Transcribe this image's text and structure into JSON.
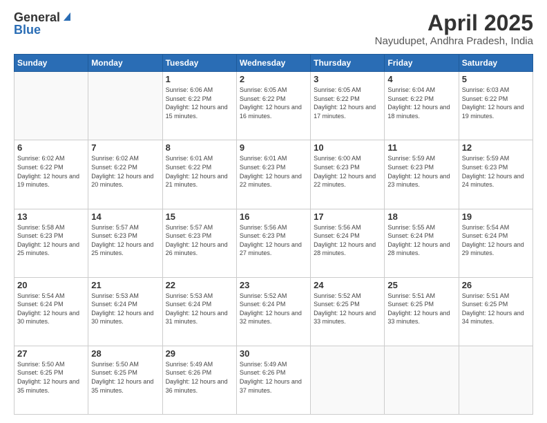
{
  "header": {
    "logo_general": "General",
    "logo_blue": "Blue",
    "title": "April 2025",
    "location": "Nayudupet, Andhra Pradesh, India"
  },
  "days_of_week": [
    "Sunday",
    "Monday",
    "Tuesday",
    "Wednesday",
    "Thursday",
    "Friday",
    "Saturday"
  ],
  "weeks": [
    [
      {
        "day": "",
        "sunrise": "",
        "sunset": "",
        "daylight": "",
        "empty": true
      },
      {
        "day": "",
        "sunrise": "",
        "sunset": "",
        "daylight": "",
        "empty": true
      },
      {
        "day": "1",
        "sunrise": "Sunrise: 6:06 AM",
        "sunset": "Sunset: 6:22 PM",
        "daylight": "Daylight: 12 hours and 15 minutes.",
        "empty": false
      },
      {
        "day": "2",
        "sunrise": "Sunrise: 6:05 AM",
        "sunset": "Sunset: 6:22 PM",
        "daylight": "Daylight: 12 hours and 16 minutes.",
        "empty": false
      },
      {
        "day": "3",
        "sunrise": "Sunrise: 6:05 AM",
        "sunset": "Sunset: 6:22 PM",
        "daylight": "Daylight: 12 hours and 17 minutes.",
        "empty": false
      },
      {
        "day": "4",
        "sunrise": "Sunrise: 6:04 AM",
        "sunset": "Sunset: 6:22 PM",
        "daylight": "Daylight: 12 hours and 18 minutes.",
        "empty": false
      },
      {
        "day": "5",
        "sunrise": "Sunrise: 6:03 AM",
        "sunset": "Sunset: 6:22 PM",
        "daylight": "Daylight: 12 hours and 19 minutes.",
        "empty": false
      }
    ],
    [
      {
        "day": "6",
        "sunrise": "Sunrise: 6:02 AM",
        "sunset": "Sunset: 6:22 PM",
        "daylight": "Daylight: 12 hours and 19 minutes.",
        "empty": false
      },
      {
        "day": "7",
        "sunrise": "Sunrise: 6:02 AM",
        "sunset": "Sunset: 6:22 PM",
        "daylight": "Daylight: 12 hours and 20 minutes.",
        "empty": false
      },
      {
        "day": "8",
        "sunrise": "Sunrise: 6:01 AM",
        "sunset": "Sunset: 6:22 PM",
        "daylight": "Daylight: 12 hours and 21 minutes.",
        "empty": false
      },
      {
        "day": "9",
        "sunrise": "Sunrise: 6:01 AM",
        "sunset": "Sunset: 6:23 PM",
        "daylight": "Daylight: 12 hours and 22 minutes.",
        "empty": false
      },
      {
        "day": "10",
        "sunrise": "Sunrise: 6:00 AM",
        "sunset": "Sunset: 6:23 PM",
        "daylight": "Daylight: 12 hours and 22 minutes.",
        "empty": false
      },
      {
        "day": "11",
        "sunrise": "Sunrise: 5:59 AM",
        "sunset": "Sunset: 6:23 PM",
        "daylight": "Daylight: 12 hours and 23 minutes.",
        "empty": false
      },
      {
        "day": "12",
        "sunrise": "Sunrise: 5:59 AM",
        "sunset": "Sunset: 6:23 PM",
        "daylight": "Daylight: 12 hours and 24 minutes.",
        "empty": false
      }
    ],
    [
      {
        "day": "13",
        "sunrise": "Sunrise: 5:58 AM",
        "sunset": "Sunset: 6:23 PM",
        "daylight": "Daylight: 12 hours and 25 minutes.",
        "empty": false
      },
      {
        "day": "14",
        "sunrise": "Sunrise: 5:57 AM",
        "sunset": "Sunset: 6:23 PM",
        "daylight": "Daylight: 12 hours and 25 minutes.",
        "empty": false
      },
      {
        "day": "15",
        "sunrise": "Sunrise: 5:57 AM",
        "sunset": "Sunset: 6:23 PM",
        "daylight": "Daylight: 12 hours and 26 minutes.",
        "empty": false
      },
      {
        "day": "16",
        "sunrise": "Sunrise: 5:56 AM",
        "sunset": "Sunset: 6:23 PM",
        "daylight": "Daylight: 12 hours and 27 minutes.",
        "empty": false
      },
      {
        "day": "17",
        "sunrise": "Sunrise: 5:56 AM",
        "sunset": "Sunset: 6:24 PM",
        "daylight": "Daylight: 12 hours and 28 minutes.",
        "empty": false
      },
      {
        "day": "18",
        "sunrise": "Sunrise: 5:55 AM",
        "sunset": "Sunset: 6:24 PM",
        "daylight": "Daylight: 12 hours and 28 minutes.",
        "empty": false
      },
      {
        "day": "19",
        "sunrise": "Sunrise: 5:54 AM",
        "sunset": "Sunset: 6:24 PM",
        "daylight": "Daylight: 12 hours and 29 minutes.",
        "empty": false
      }
    ],
    [
      {
        "day": "20",
        "sunrise": "Sunrise: 5:54 AM",
        "sunset": "Sunset: 6:24 PM",
        "daylight": "Daylight: 12 hours and 30 minutes.",
        "empty": false
      },
      {
        "day": "21",
        "sunrise": "Sunrise: 5:53 AM",
        "sunset": "Sunset: 6:24 PM",
        "daylight": "Daylight: 12 hours and 30 minutes.",
        "empty": false
      },
      {
        "day": "22",
        "sunrise": "Sunrise: 5:53 AM",
        "sunset": "Sunset: 6:24 PM",
        "daylight": "Daylight: 12 hours and 31 minutes.",
        "empty": false
      },
      {
        "day": "23",
        "sunrise": "Sunrise: 5:52 AM",
        "sunset": "Sunset: 6:24 PM",
        "daylight": "Daylight: 12 hours and 32 minutes.",
        "empty": false
      },
      {
        "day": "24",
        "sunrise": "Sunrise: 5:52 AM",
        "sunset": "Sunset: 6:25 PM",
        "daylight": "Daylight: 12 hours and 33 minutes.",
        "empty": false
      },
      {
        "day": "25",
        "sunrise": "Sunrise: 5:51 AM",
        "sunset": "Sunset: 6:25 PM",
        "daylight": "Daylight: 12 hours and 33 minutes.",
        "empty": false
      },
      {
        "day": "26",
        "sunrise": "Sunrise: 5:51 AM",
        "sunset": "Sunset: 6:25 PM",
        "daylight": "Daylight: 12 hours and 34 minutes.",
        "empty": false
      }
    ],
    [
      {
        "day": "27",
        "sunrise": "Sunrise: 5:50 AM",
        "sunset": "Sunset: 6:25 PM",
        "daylight": "Daylight: 12 hours and 35 minutes.",
        "empty": false
      },
      {
        "day": "28",
        "sunrise": "Sunrise: 5:50 AM",
        "sunset": "Sunset: 6:25 PM",
        "daylight": "Daylight: 12 hours and 35 minutes.",
        "empty": false
      },
      {
        "day": "29",
        "sunrise": "Sunrise: 5:49 AM",
        "sunset": "Sunset: 6:26 PM",
        "daylight": "Daylight: 12 hours and 36 minutes.",
        "empty": false
      },
      {
        "day": "30",
        "sunrise": "Sunrise: 5:49 AM",
        "sunset": "Sunset: 6:26 PM",
        "daylight": "Daylight: 12 hours and 37 minutes.",
        "empty": false
      },
      {
        "day": "",
        "sunrise": "",
        "sunset": "",
        "daylight": "",
        "empty": true
      },
      {
        "day": "",
        "sunrise": "",
        "sunset": "",
        "daylight": "",
        "empty": true
      },
      {
        "day": "",
        "sunrise": "",
        "sunset": "",
        "daylight": "",
        "empty": true
      }
    ]
  ]
}
